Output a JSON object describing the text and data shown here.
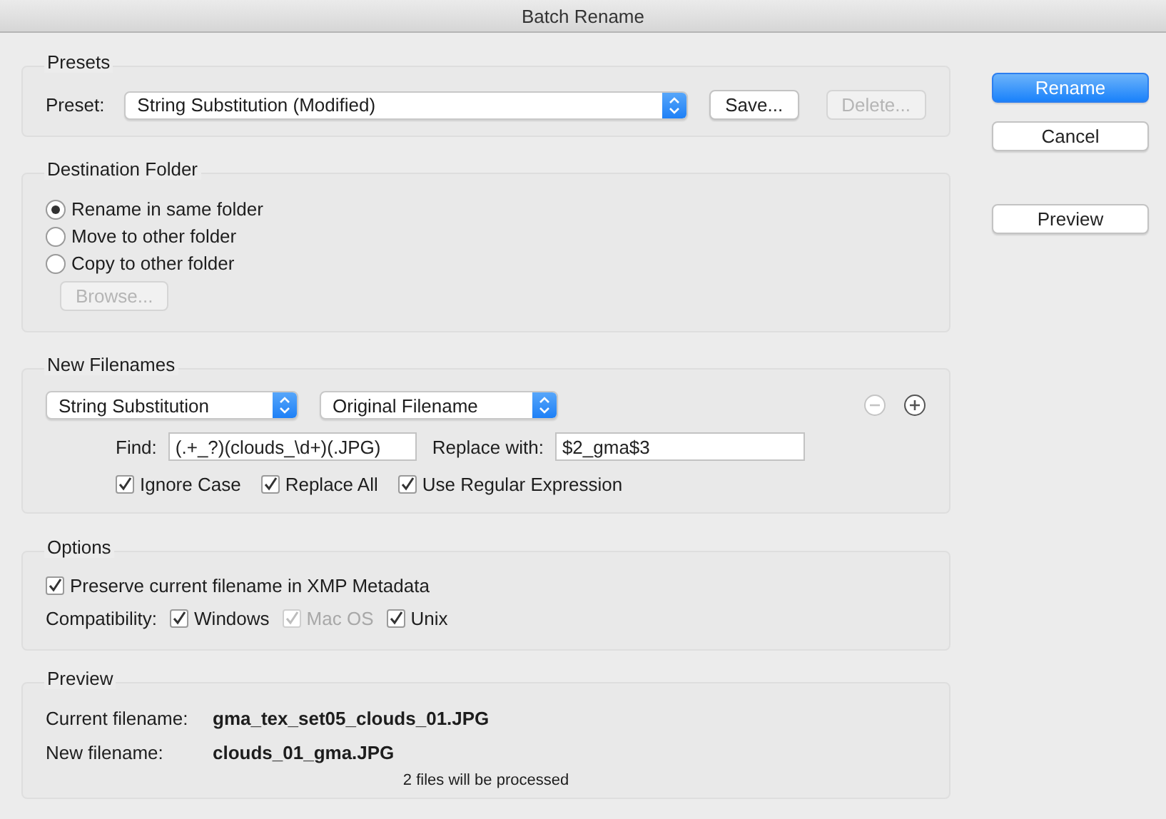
{
  "window": {
    "title": "Batch Rename"
  },
  "presets": {
    "title": "Presets",
    "label": "Preset:",
    "value": "String Substitution (Modified)",
    "buttons": [
      {
        "label": "Save...",
        "disabled": false
      },
      {
        "label": "Delete...",
        "disabled": true
      }
    ]
  },
  "destination": {
    "title": "Destination Folder",
    "options": [
      {
        "label": "Rename in same folder",
        "selected": true
      },
      {
        "label": "Move to other folder",
        "selected": false
      },
      {
        "label": "Copy to other folder",
        "selected": false
      }
    ],
    "browse": {
      "label": "Browse...",
      "disabled": true
    }
  },
  "new_filenames": {
    "title": "New Filenames",
    "selects": [
      "String Substitution",
      "Original Filename"
    ],
    "row_buttons": [
      {
        "kind": "remove",
        "disabled": true
      },
      {
        "kind": "add",
        "disabled": false
      }
    ],
    "find_label": "Find:",
    "find_value": "(.+_?)(clouds_\\d+)(.JPG)",
    "replace_label": "Replace with:",
    "replace_value": "$2_gma$3",
    "checks": [
      {
        "label": "Ignore Case",
        "checked": true
      },
      {
        "label": "Replace All",
        "checked": true
      },
      {
        "label": "Use Regular Expression",
        "checked": true
      }
    ]
  },
  "options": {
    "title": "Options",
    "preserve": {
      "label": "Preserve current filename in XMP Metadata",
      "checked": true
    },
    "compat_label": "Compatibility:",
    "compat": [
      {
        "label": "Windows",
        "checked": true,
        "disabled": false
      },
      {
        "label": "Mac OS",
        "checked": true,
        "disabled": true
      },
      {
        "label": "Unix",
        "checked": true,
        "disabled": false
      }
    ]
  },
  "preview": {
    "title": "Preview",
    "rows": [
      {
        "label": "Current filename:",
        "value": "gma_tex_set05_clouds_01.JPG"
      },
      {
        "label": "New filename:",
        "value": "clouds_01_gma.JPG"
      }
    ],
    "note": "2 files will be processed"
  },
  "actions": [
    {
      "label": "Rename",
      "kind": "primary"
    },
    {
      "label": "Cancel",
      "kind": "default"
    },
    {
      "label": "Preview",
      "kind": "default"
    }
  ]
}
